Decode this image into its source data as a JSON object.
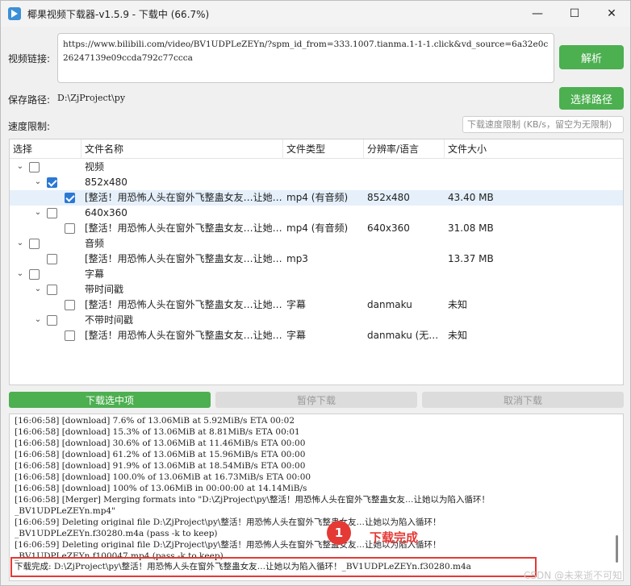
{
  "window": {
    "title": "椰果视频下载器-v1.5.9 - 下载中 (66.7%)",
    "progress_percent": 66.7,
    "minimize_glyph": "—",
    "maximize_glyph": "☐",
    "close_glyph": "✕"
  },
  "form": {
    "url_label": "视频链接:",
    "url_value": "https://www.bilibili.com/video/BV1UDPLeZEYn/?spm_id_from=333.1007.tianma.1-1-1.click&vd_source=6a32e0c26247139e09ccda792c77ccca",
    "parse_button": "解析",
    "path_label": "保存路径:",
    "path_value": "D:\\ZjProject\\py",
    "choose_path_button": "选择路径",
    "speed_label": "速度限制:",
    "speed_placeholder": "下载速度限制 (KB/s，留空为无限制)"
  },
  "tree": {
    "columns": [
      "选择",
      "文件名称",
      "文件类型",
      "分辨率/语言",
      "文件大小"
    ],
    "rows": [
      {
        "level": 0,
        "expand": "⌄",
        "checked": false,
        "name": "视频",
        "type": "",
        "res": "",
        "size": ""
      },
      {
        "level": 1,
        "expand": "⌄",
        "checked": true,
        "name": "852x480",
        "type": "",
        "res": "",
        "size": ""
      },
      {
        "level": 2,
        "expand": "",
        "checked": true,
        "name": "[整活！用恐怖人头在窗外飞整蛊女友…让她…",
        "type": "mp4 (有音频)",
        "res": "852x480",
        "size": "43.40 MB"
      },
      {
        "level": 1,
        "expand": "⌄",
        "checked": false,
        "name": "640x360",
        "type": "",
        "res": "",
        "size": ""
      },
      {
        "level": 2,
        "expand": "",
        "checked": false,
        "name": "[整活！用恐怖人头在窗外飞整蛊女友…让她…",
        "type": "mp4 (有音频)",
        "res": "640x360",
        "size": "31.08 MB"
      },
      {
        "level": 0,
        "expand": "⌄",
        "checked": false,
        "name": "音频",
        "type": "",
        "res": "",
        "size": ""
      },
      {
        "level": 1,
        "expand": "",
        "checked": false,
        "name": "[整活！用恐怖人头在窗外飞整蛊女友…让她…",
        "type": "mp3",
        "res": "",
        "size": "13.37 MB"
      },
      {
        "level": 0,
        "expand": "⌄",
        "checked": false,
        "name": "字幕",
        "type": "",
        "res": "",
        "size": ""
      },
      {
        "level": 1,
        "expand": "⌄",
        "checked": false,
        "name": "带时间戳",
        "type": "",
        "res": "",
        "size": ""
      },
      {
        "level": 2,
        "expand": "",
        "checked": false,
        "name": "[整活！用恐怖人头在窗外飞整蛊女友…让她…",
        "type": "字幕",
        "res": "danmaku",
        "size": "未知"
      },
      {
        "level": 1,
        "expand": "⌄",
        "checked": false,
        "name": "不带时间戳",
        "type": "",
        "res": "",
        "size": ""
      },
      {
        "level": 2,
        "expand": "",
        "checked": false,
        "name": "[整活！用恐怖人头在窗外飞整蛊女友…让她…",
        "type": "字幕",
        "res": "danmaku (无…",
        "size": "未知"
      }
    ]
  },
  "actions": {
    "download_selected": "下载选中项",
    "pause": "暂停下载",
    "cancel": "取消下载"
  },
  "log": {
    "lines": [
      "[16:06:58] [download]   7.6% of   13.06MiB at    5.92MiB/s ETA 00:02",
      "[16:06:58] [download]  15.3% of   13.06MiB at    8.81MiB/s ETA 00:01",
      "[16:06:58] [download]  30.6% of   13.06MiB at   11.46MiB/s ETA 00:00",
      "[16:06:58] [download]  61.2% of   13.06MiB at   15.96MiB/s ETA 00:00",
      "[16:06:58] [download]  91.9% of   13.06MiB at   18.54MiB/s ETA 00:00",
      "[16:06:58] [download] 100.0% of   13.06MiB at   16.73MiB/s ETA 00:00",
      "[16:06:58] [download] 100% of   13.06MiB in 00:00:00 at 14.14MiB/s",
      "[16:06:58] [Merger] Merging formats into \"D:\\ZjProject\\py\\整活！用恐怖人头在窗外飞整蛊女友…让她以为陷入循环！",
      "_BV1UDPLeZEYn.mp4\"",
      "[16:06:59] Deleting original file D:\\ZjProject\\py\\整活！用恐怖人头在窗外飞整蛊女友…让她以为陷入循环！",
      "_BV1UDPLeZEYn.f30280.m4a (pass -k to keep)",
      "[16:06:59] Deleting original file D:\\ZjProject\\py\\整活！用恐怖人头在窗外飞整蛊女友…让她以为陷入循环！",
      "_BV1UDPLeZEYn.f100047.mp4 (pass -k to keep)"
    ],
    "final_line": "下载完成: D:\\ZjProject\\py\\整活！用恐怖人头在窗外飞整蛊女友…让她以为陷入循环！_BV1UDPLeZEYn.f30280.m4a"
  },
  "annotation": {
    "number": "1",
    "text": "下载完成",
    "color": "#e53935"
  },
  "watermark": "CSDN @未来逝不可知",
  "colors": {
    "accent_green": "#4caf50",
    "checkbox_blue": "#2b78d4",
    "disabled_button": "#dcdcdc"
  }
}
